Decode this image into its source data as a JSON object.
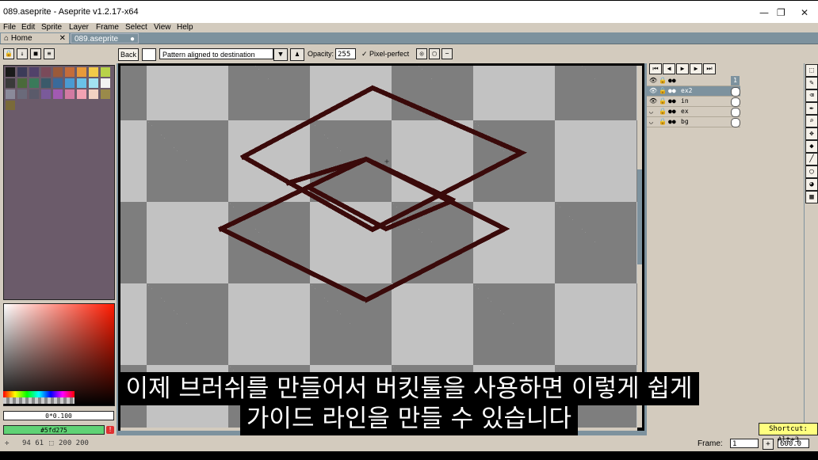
{
  "window": {
    "title": "089.aseprite - Aseprite v1.2.17-x64"
  },
  "menu": [
    "File",
    "Edit",
    "Sprite",
    "Layer",
    "Frame",
    "Select",
    "View",
    "Help"
  ],
  "tabs": [
    {
      "label": "Home",
      "close": "✕"
    },
    {
      "label": "089.aseprite"
    }
  ],
  "toolbar": {
    "back_label": "Back",
    "pattern_option": "Pattern aligned to destination",
    "opacity_label": "Opacity:",
    "opacity_value": "255",
    "pixel_perfect_label": "Pixel-perfect"
  },
  "palette": {
    "colors": [
      "#1a1a1a",
      "#3b3b58",
      "#51426a",
      "#7a4a5a",
      "#9a5a3a",
      "#c46c3a",
      "#e89a3a",
      "#f2cb4a",
      "#b8d24a",
      "#3a3a3a",
      "#4a6a3a",
      "#3a7a5a",
      "#3a5a6a",
      "#3a6a9a",
      "#4a9ad2",
      "#6ac2e8",
      "#a2e2f2",
      "#f2f2f2",
      "#8a8a9a",
      "#6a6a7a",
      "#5a5a6a",
      "#7a5a9a",
      "#a25ab2",
      "#d27aa2",
      "#f2a2b2",
      "#f2d2c2",
      "#9a8a4a",
      "#7a6a3a"
    ],
    "fg_color_label": "0*0.100",
    "bg_color_label": "#5fd275"
  },
  "layers": [
    {
      "name": "",
      "is_header": true
    },
    {
      "name": "ex2",
      "selected": true
    },
    {
      "name": "in"
    },
    {
      "name": "ex"
    },
    {
      "name": "bg"
    }
  ],
  "timeline": {
    "frame_header": "1"
  },
  "status": {
    "coords": "94  61",
    "size": "200 200",
    "frame_label": "Frame:",
    "frame_value": "1",
    "zoom_value": "600.0",
    "shortcut_tip": "Shortcut: Alt+3"
  },
  "subtitle": {
    "line1": "이제 브러쉬를 만들어서 버킷툴을 사용하면 이렇게 쉽게",
    "line2": "가이드 라인을 만들 수 있습니다"
  },
  "colors": {
    "accent": "#7d929e",
    "panel": "#d3cbbe",
    "stroke": "#3a0a0a"
  }
}
